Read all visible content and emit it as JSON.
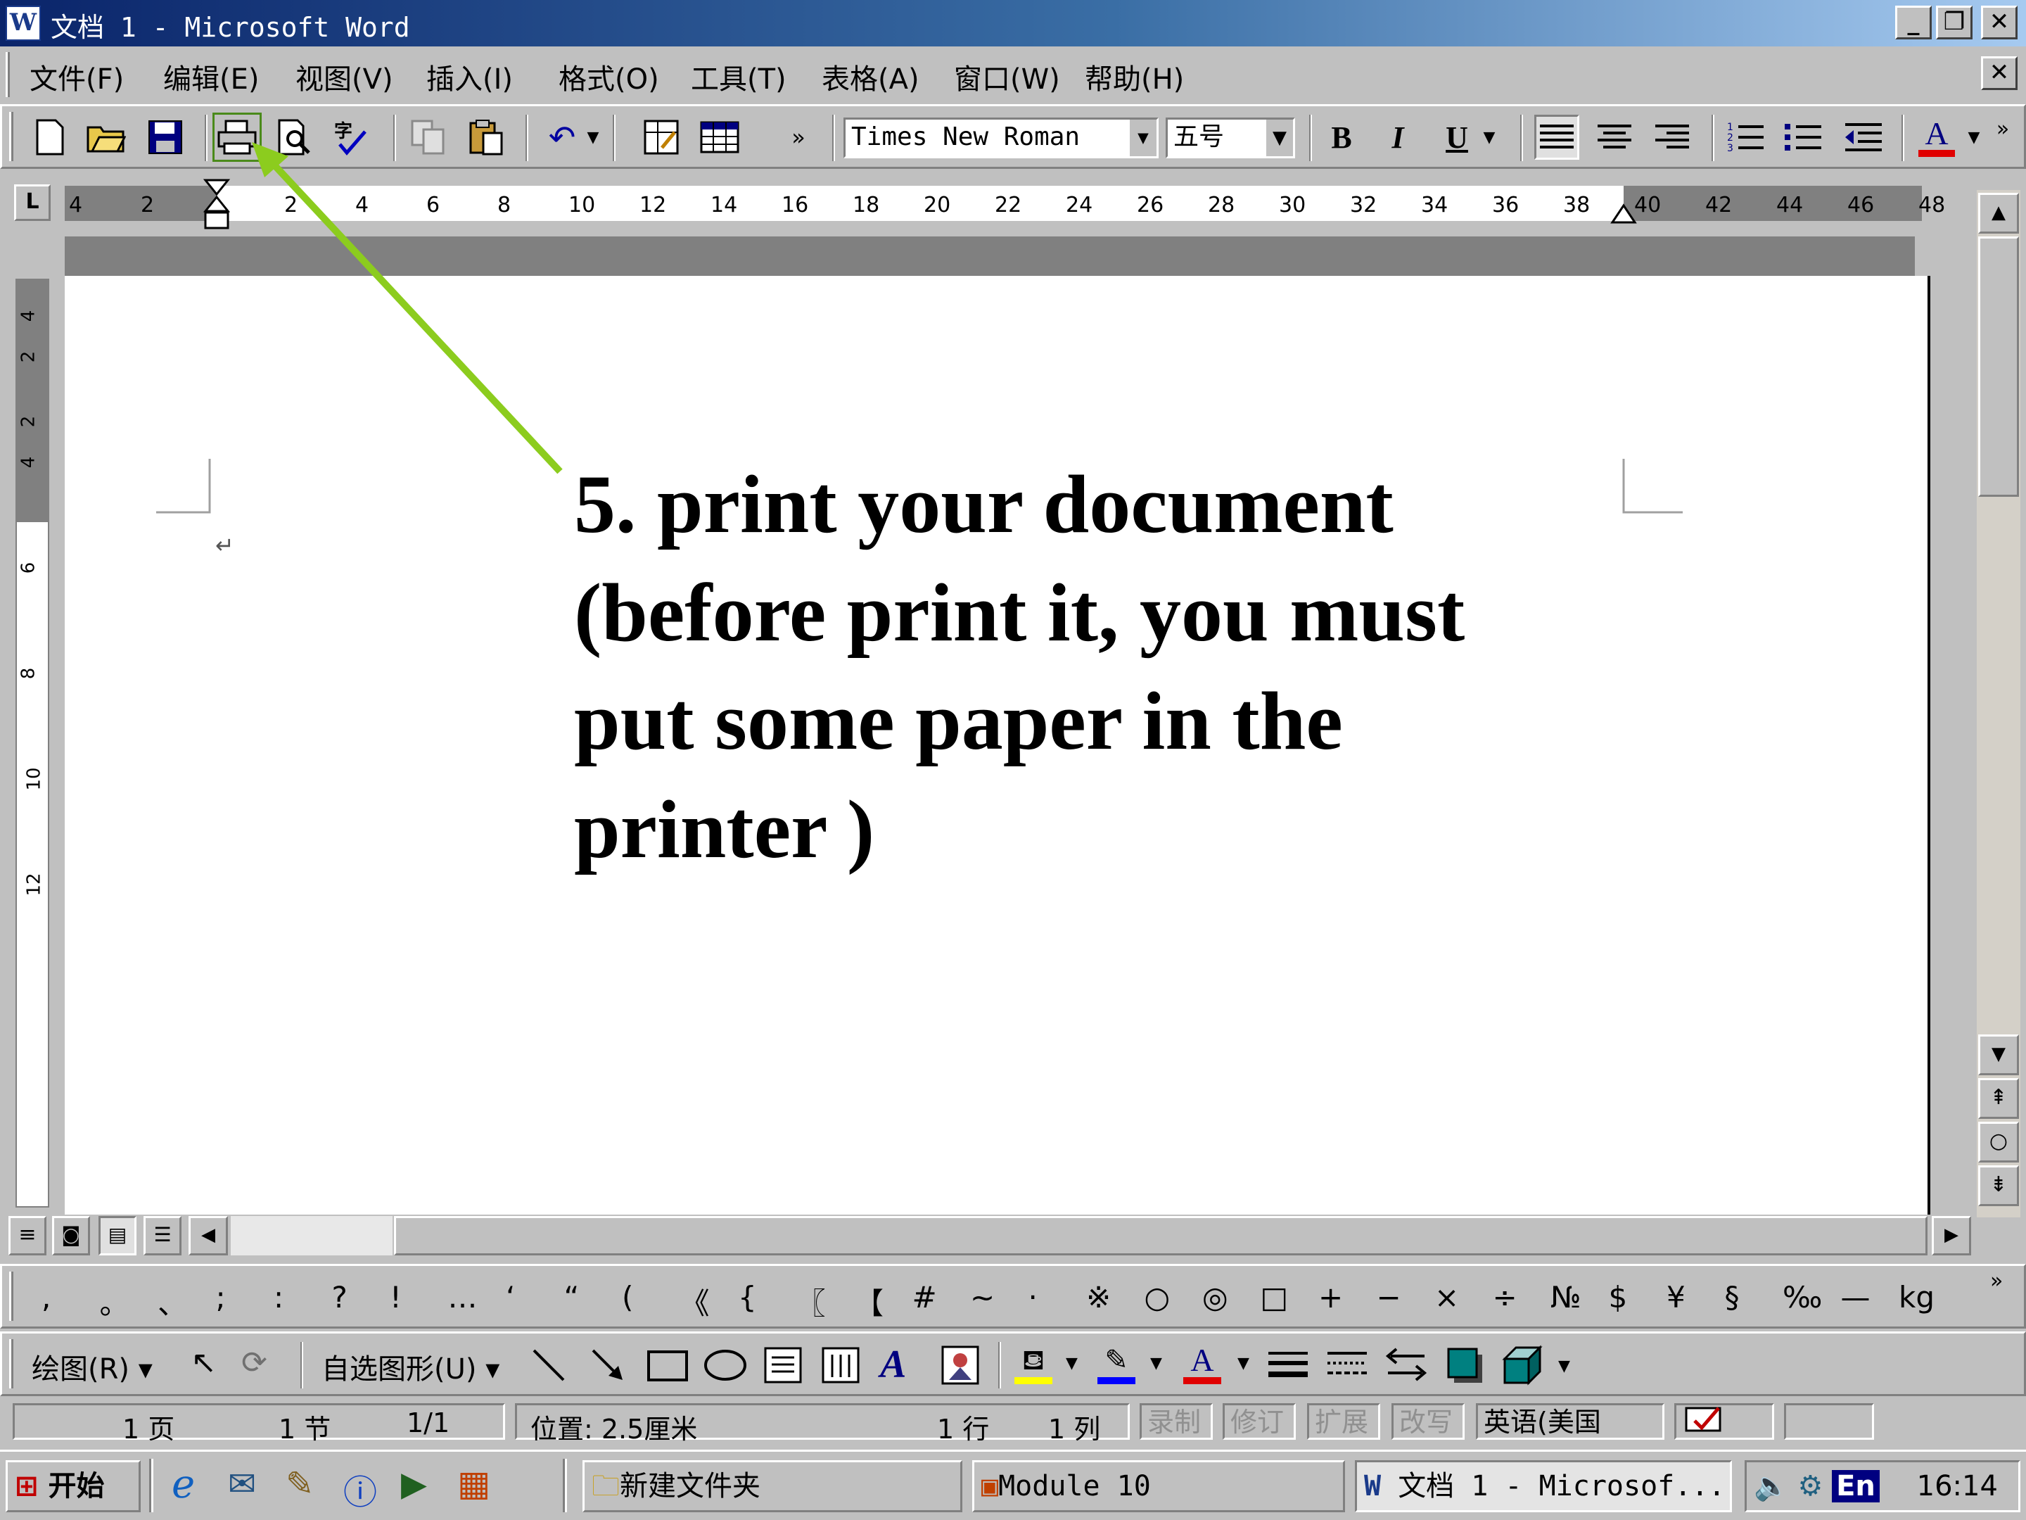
{
  "window": {
    "title": "文档 1 - Microsoft Word",
    "controls": [
      "_",
      "❐",
      "✕"
    ]
  },
  "menu": [
    "文件(F)",
    "编辑(E)",
    "视图(V)",
    "插入(I)",
    "格式(O)",
    "工具(T)",
    "表格(A)",
    "窗口(W)",
    "帮助(H)"
  ],
  "toolbar": {
    "more": "»",
    "font": "Times New Roman",
    "size": "五号",
    "bold": "B",
    "italic": "I",
    "underline": "U",
    "font_color": "A"
  },
  "ruler": {
    "tab_marker": "L",
    "labels": [
      "4",
      "2",
      "2",
      "4",
      "6",
      "8",
      "10",
      "12",
      "14",
      "16",
      "18",
      "20",
      "22",
      "24",
      "26",
      "28",
      "30",
      "32",
      "34",
      "36",
      "38",
      "40",
      "42",
      "44",
      "46",
      "48"
    ]
  },
  "vruler": {
    "labels": [
      "4",
      "2",
      "2",
      "4",
      "6",
      "8",
      "10",
      "12"
    ]
  },
  "document": {
    "lines": [
      "5. print your document",
      "(before print it, you must",
      "put some paper in the",
      "printer )"
    ],
    "paragraph_mark": "↵"
  },
  "symbols": [
    ",",
    "。",
    "、",
    ";",
    ":",
    "?",
    "!",
    "…",
    "‘",
    "“",
    "(",
    "《",
    "{",
    "〖",
    "【",
    "#",
    "~",
    "·",
    "※",
    "○",
    "◎",
    "□",
    "+",
    "−",
    "×",
    "÷",
    "№",
    "$",
    "¥",
    "§",
    "‰",
    "—",
    "kg"
  ],
  "drawing": {
    "draw_label": "绘图(R)",
    "autoshape_label": "自选图形(U)"
  },
  "status": {
    "page": "1 页",
    "section": "1 节",
    "pages": "1/1",
    "position": "位置: 2.5厘米",
    "line": "1 行",
    "col": "1 列",
    "rec": "录制",
    "trk": "修订",
    "ext": "扩展",
    "ovr": "改写",
    "lang": "英语(美国"
  },
  "taskbar": {
    "start": "开始",
    "tasks": [
      "新建文件夹",
      "Module 10",
      "文档 1 - Microsof..."
    ],
    "lang": "En",
    "time": "16:14"
  },
  "colors": {
    "arrow": "#8ccc1e",
    "titlebar": "#0a246a",
    "font_color_bar": "#e00000",
    "highlight": "#ffff00",
    "line_color": "#0000ff"
  }
}
